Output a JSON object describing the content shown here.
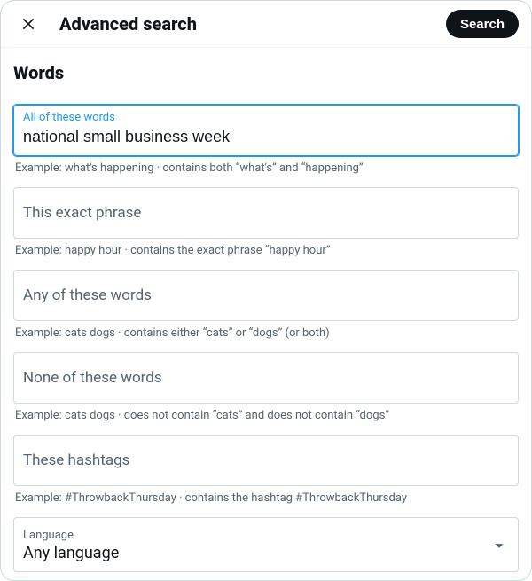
{
  "header": {
    "title": "Advanced search",
    "search_button": "Search"
  },
  "section": {
    "title": "Words"
  },
  "fields": {
    "all_words": {
      "label": "All of these words",
      "value": "national small business week",
      "example": "Example: what's happening · contains both “what's” and “happening”"
    },
    "exact_phrase": {
      "label": "This exact phrase",
      "example": "Example: happy hour · contains the exact phrase “happy hour”"
    },
    "any_words": {
      "label": "Any of these words",
      "example": "Example: cats dogs · contains either “cats” or “dogs” (or both)"
    },
    "none_words": {
      "label": "None of these words",
      "example": "Example: cats dogs · does not contain “cats” and does not contain “dogs”"
    },
    "hashtags": {
      "label": "These hashtags",
      "example": "Example: #ThrowbackThursday · contains the hashtag #ThrowbackThursday"
    },
    "language": {
      "label": "Language",
      "value": "Any language"
    }
  }
}
